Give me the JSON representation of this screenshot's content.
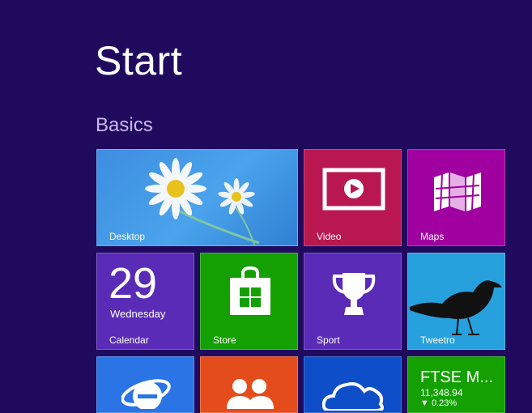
{
  "screen": {
    "title": "Start",
    "group": "Basics"
  },
  "tiles": {
    "desktop": {
      "label": "Desktop",
      "icon": "daisy-wallpaper"
    },
    "video": {
      "label": "Video",
      "icon": "video-icon"
    },
    "maps": {
      "label": "Maps",
      "icon": "map-icon"
    },
    "calendar": {
      "label": "Calendar",
      "date": "29",
      "weekday": "Wednesday"
    },
    "store": {
      "label": "Store",
      "icon": "store-bag-icon"
    },
    "sport": {
      "label": "Sport",
      "icon": "trophy-icon"
    },
    "tweetro": {
      "label": "Tweetro",
      "icon": "bird-icon"
    },
    "ie": {
      "icon": "internet-explorer-icon"
    },
    "people": {
      "icon": "people-icon"
    },
    "skydrive": {
      "icon": "cloud-icon"
    },
    "finance": {
      "title": "FTSE M...",
      "value": "11,348.94",
      "change": "▼ 0.23%"
    }
  },
  "colors": {
    "background": "#1f0a5e",
    "video": "#b8174f",
    "maps": "#9f009f",
    "purple_tile": "#5a2bb7",
    "green_tile": "#13a000",
    "tweetro": "#26a1dd",
    "ie": "#2a74e5",
    "people": "#e44d1b",
    "skydrive": "#0f4ec9"
  }
}
